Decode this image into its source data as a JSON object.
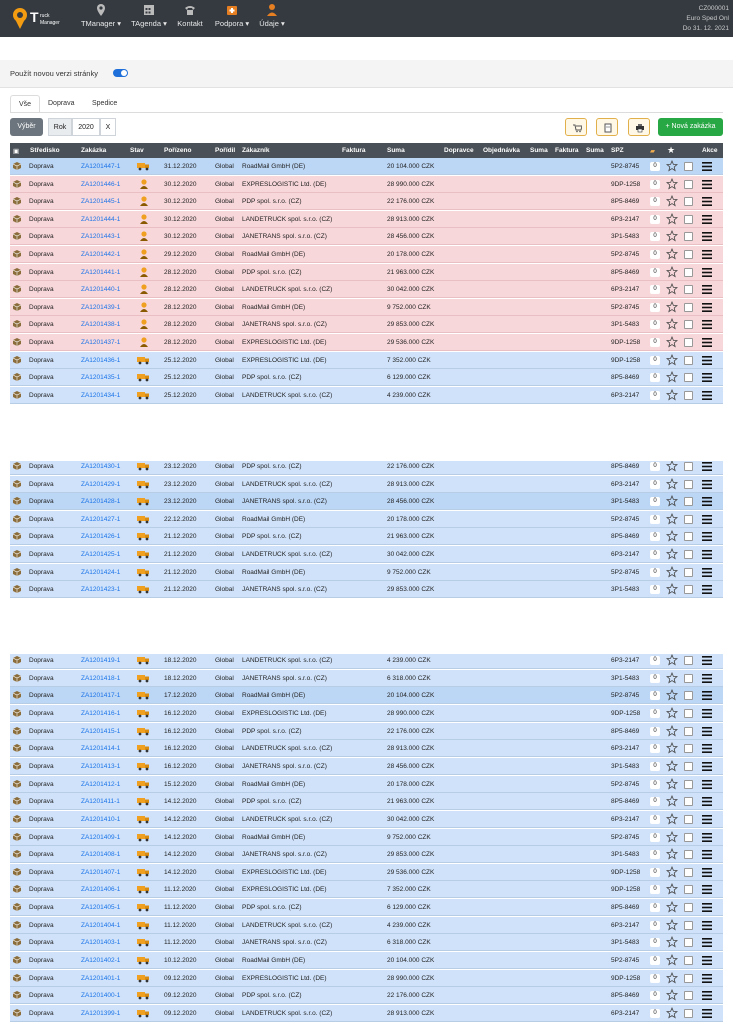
{
  "app": {
    "logo_text": "T",
    "logo_sub1": "ruck",
    "logo_sub2": "Manager",
    "company_id": "CZ000001",
    "company_name": "Euro Sped Onl",
    "valid_until": "Do 31. 12. 2021",
    "nav": [
      {
        "label": "TManager",
        "icon": "map-pin-icon"
      },
      {
        "label": "TAgenda",
        "icon": "calendar-grid-icon"
      },
      {
        "label": "Kontakt",
        "icon": "phone-icon"
      },
      {
        "label": "Podpora",
        "icon": "first-aid-icon"
      },
      {
        "label": "Údaje",
        "icon": "user-icon"
      }
    ]
  },
  "switch": {
    "label": "Použít novou verzi stránky",
    "on": true
  },
  "tabs": [
    "Vše",
    "Doprava",
    "Spedice"
  ],
  "filters": {
    "vyber": "Výběr",
    "rok_label": "Rok",
    "rok_value": "2020",
    "clear": "X",
    "new_order": "+ Nová zakázka"
  },
  "columns": {
    "stredisko": "Středisko",
    "zakazka": "Zakázka",
    "stav": "Stav",
    "porizeno": "Pořízeno",
    "poridil": "Pořídil",
    "zakaznik": "Zákazník",
    "faktura": "Faktura",
    "suma": "Suma",
    "dopravce": "Dopravce",
    "objednavka": "Objednávka",
    "suma2": "Suma",
    "faktura2": "Faktura",
    "suma3": "Suma",
    "spz": "SPZ",
    "akce": "Akce"
  },
  "colors": {
    "header": "#343a40",
    "row_blue": "#cfe2fa",
    "row_pink": "#f8d7da",
    "accent": "#1e6fd9",
    "green": "#28a745"
  },
  "rows": [
    {
      "s": "Doprava",
      "z": "ZA1201447-1",
      "icon": "truck",
      "d": "31.12.2020",
      "p": "Global",
      "c": "RoadMail GmbH (DE)",
      "sum": "20 104.000 CZK",
      "spz": "5P2-8745",
      "n": "0",
      "t": "hl"
    },
    {
      "s": "Doprava",
      "z": "ZA1201446-1",
      "icon": "person",
      "d": "30.12.2020",
      "p": "Global",
      "c": "EXPRESLOGISTIC Ltd. (DE)",
      "sum": "28 990.000 CZK",
      "spz": "9DP-1258",
      "n": "0",
      "t": "pink"
    },
    {
      "s": "Doprava",
      "z": "ZA1201445-1",
      "icon": "person",
      "d": "30.12.2020",
      "p": "Global",
      "c": "PDP spol. s.r.o. (CZ)",
      "sum": "22 176.000 CZK",
      "spz": "8P5-8469",
      "n": "0",
      "t": "pink"
    },
    {
      "s": "Doprava",
      "z": "ZA1201444-1",
      "icon": "person",
      "d": "30.12.2020",
      "p": "Global",
      "c": "LANDETRUCK spol. s.r.o. (CZ)",
      "sum": "28 913.000 CZK",
      "spz": "6P3-2147",
      "n": "0",
      "t": "pink"
    },
    {
      "s": "Doprava",
      "z": "ZA1201443-1",
      "icon": "person",
      "d": "30.12.2020",
      "p": "Global",
      "c": "JANETRANS spol. s.r.o. (CZ)",
      "sum": "28 456.000 CZK",
      "spz": "3P1-5483",
      "n": "0",
      "t": "pink"
    },
    {
      "s": "Doprava",
      "z": "ZA1201442-1",
      "icon": "person",
      "d": "29.12.2020",
      "p": "Global",
      "c": "RoadMail GmbH (DE)",
      "sum": "20 178.000 CZK",
      "spz": "5P2-8745",
      "n": "0",
      "t": "pink"
    },
    {
      "s": "Doprava",
      "z": "ZA1201441-1",
      "icon": "person",
      "d": "28.12.2020",
      "p": "Global",
      "c": "PDP spol. s.r.o. (CZ)",
      "sum": "21 963.000 CZK",
      "spz": "8P5-8469",
      "n": "0",
      "t": "pink"
    },
    {
      "s": "Doprava",
      "z": "ZA1201440-1",
      "icon": "person",
      "d": "28.12.2020",
      "p": "Global",
      "c": "LANDETRUCK spol. s.r.o. (CZ)",
      "sum": "30 042.000 CZK",
      "spz": "6P3-2147",
      "n": "0",
      "t": "pink"
    },
    {
      "s": "Doprava",
      "z": "ZA1201439-1",
      "icon": "person",
      "d": "28.12.2020",
      "p": "Global",
      "c": "RoadMail GmbH (DE)",
      "sum": "9 752.000 CZK",
      "spz": "5P2-8745",
      "n": "0",
      "t": "pink"
    },
    {
      "s": "Doprava",
      "z": "ZA1201438-1",
      "icon": "person",
      "d": "28.12.2020",
      "p": "Global",
      "c": "JANETRANS spol. s.r.o. (CZ)",
      "sum": "29 853.000 CZK",
      "spz": "3P1-5483",
      "n": "0",
      "t": "pink"
    },
    {
      "s": "Doprava",
      "z": "ZA1201437-1",
      "icon": "person",
      "d": "28.12.2020",
      "p": "Global",
      "c": "EXPRESLOGISTIC Ltd. (DE)",
      "sum": "29 536.000 CZK",
      "spz": "9DP-1258",
      "n": "0",
      "t": "pink"
    },
    {
      "s": "Doprava",
      "z": "ZA1201436-1",
      "icon": "truck",
      "d": "25.12.2020",
      "p": "Global",
      "c": "EXPRESLOGISTIC Ltd. (DE)",
      "sum": "7 352.000 CZK",
      "spz": "9DP-1258",
      "n": "0",
      "t": "blue"
    },
    {
      "s": "Doprava",
      "z": "ZA1201435-1",
      "icon": "truck",
      "d": "25.12.2020",
      "p": "Global",
      "c": "PDP spol. s.r.o. (CZ)",
      "sum": "6 129.000 CZK",
      "spz": "8P5-8469",
      "n": "0",
      "t": "blue"
    },
    {
      "s": "Doprava",
      "z": "ZA1201434-1",
      "icon": "truck",
      "d": "25.12.2020",
      "p": "Global",
      "c": "LANDETRUCK spol. s.r.o. (CZ)",
      "sum": "4 239.000 CZK",
      "spz": "6P3-2147",
      "n": "0",
      "t": "blue"
    },
    {
      "s": "Doprava",
      "z": "ZA1201430-1",
      "icon": "truck",
      "d": "23.12.2020",
      "p": "Global",
      "c": "PDP spol. s.r.o. (CZ)",
      "sum": "22 176.000 CZK",
      "spz": "8P5-8469",
      "n": "0",
      "t": "blue"
    },
    {
      "s": "Doprava",
      "z": "ZA1201429-1",
      "icon": "truck",
      "d": "23.12.2020",
      "p": "Global",
      "c": "LANDETRUCK spol. s.r.o. (CZ)",
      "sum": "28 913.000 CZK",
      "spz": "6P3-2147",
      "n": "0",
      "t": "blue"
    },
    {
      "s": "Doprava",
      "z": "ZA1201428-1",
      "icon": "truck",
      "d": "23.12.2020",
      "p": "Global",
      "c": "JANETRANS spol. s.r.o. (CZ)",
      "sum": "28 456.000 CZK",
      "spz": "3P1-5483",
      "n": "0",
      "t": "hl"
    },
    {
      "s": "Doprava",
      "z": "ZA1201427-1",
      "icon": "truck",
      "d": "22.12.2020",
      "p": "Global",
      "c": "RoadMail GmbH (DE)",
      "sum": "20 178.000 CZK",
      "spz": "5P2-8745",
      "n": "0",
      "t": "blue"
    },
    {
      "s": "Doprava",
      "z": "ZA1201426-1",
      "icon": "truck",
      "d": "21.12.2020",
      "p": "Global",
      "c": "PDP spol. s.r.o. (CZ)",
      "sum": "21 963.000 CZK",
      "spz": "8P5-8469",
      "n": "0",
      "t": "blue"
    },
    {
      "s": "Doprava",
      "z": "ZA1201425-1",
      "icon": "truck",
      "d": "21.12.2020",
      "p": "Global",
      "c": "LANDETRUCK spol. s.r.o. (CZ)",
      "sum": "30 042.000 CZK",
      "spz": "6P3-2147",
      "n": "0",
      "t": "blue"
    },
    {
      "s": "Doprava",
      "z": "ZA1201424-1",
      "icon": "truck",
      "d": "21.12.2020",
      "p": "Global",
      "c": "RoadMail GmbH (DE)",
      "sum": "9 752.000 CZK",
      "spz": "5P2-8745",
      "n": "0",
      "t": "blue"
    },
    {
      "s": "Doprava",
      "z": "ZA1201423-1",
      "icon": "truck",
      "d": "21.12.2020",
      "p": "Global",
      "c": "JANETRANS spol. s.r.o. (CZ)",
      "sum": "29 853.000 CZK",
      "spz": "3P1-5483",
      "n": "0",
      "t": "blue"
    },
    {
      "s": "Doprava",
      "z": "ZA1201419-1",
      "icon": "truck",
      "d": "18.12.2020",
      "p": "Global",
      "c": "LANDETRUCK spol. s.r.o. (CZ)",
      "sum": "4 239.000 CZK",
      "spz": "6P3-2147",
      "n": "0",
      "t": "blue"
    },
    {
      "s": "Doprava",
      "z": "ZA1201418-1",
      "icon": "truck",
      "d": "18.12.2020",
      "p": "Global",
      "c": "JANETRANS spol. s.r.o. (CZ)",
      "sum": "6 318.000 CZK",
      "spz": "3P1-5483",
      "n": "0",
      "t": "blue"
    },
    {
      "s": "Doprava",
      "z": "ZA1201417-1",
      "icon": "truck",
      "d": "17.12.2020",
      "p": "Global",
      "c": "RoadMail GmbH (DE)",
      "sum": "20 104.000 CZK",
      "spz": "5P2-8745",
      "n": "0",
      "t": "hl"
    },
    {
      "s": "Doprava",
      "z": "ZA1201416-1",
      "icon": "truck",
      "d": "16.12.2020",
      "p": "Global",
      "c": "EXPRESLOGISTIC Ltd. (DE)",
      "sum": "28 990.000 CZK",
      "spz": "9DP-1258",
      "n": "0",
      "t": "blue"
    },
    {
      "s": "Doprava",
      "z": "ZA1201415-1",
      "icon": "truck",
      "d": "16.12.2020",
      "p": "Global",
      "c": "PDP spol. s.r.o. (CZ)",
      "sum": "22 176.000 CZK",
      "spz": "8P5-8469",
      "n": "0",
      "t": "blue"
    },
    {
      "s": "Doprava",
      "z": "ZA1201414-1",
      "icon": "truck",
      "d": "16.12.2020",
      "p": "Global",
      "c": "LANDETRUCK spol. s.r.o. (CZ)",
      "sum": "28 913.000 CZK",
      "spz": "6P3-2147",
      "n": "0",
      "t": "blue"
    },
    {
      "s": "Doprava",
      "z": "ZA1201413-1",
      "icon": "truck",
      "d": "16.12.2020",
      "p": "Global",
      "c": "JANETRANS spol. s.r.o. (CZ)",
      "sum": "28 456.000 CZK",
      "spz": "3P1-5483",
      "n": "0",
      "t": "blue"
    },
    {
      "s": "Doprava",
      "z": "ZA1201412-1",
      "icon": "truck",
      "d": "15.12.2020",
      "p": "Global",
      "c": "RoadMail GmbH (DE)",
      "sum": "20 178.000 CZK",
      "spz": "5P2-8745",
      "n": "0",
      "t": "blue"
    },
    {
      "s": "Doprava",
      "z": "ZA1201411-1",
      "icon": "truck",
      "d": "14.12.2020",
      "p": "Global",
      "c": "PDP spol. s.r.o. (CZ)",
      "sum": "21 963.000 CZK",
      "spz": "8P5-8469",
      "n": "0",
      "t": "blue"
    },
    {
      "s": "Doprava",
      "z": "ZA1201410-1",
      "icon": "truck",
      "d": "14.12.2020",
      "p": "Global",
      "c": "LANDETRUCK spol. s.r.o. (CZ)",
      "sum": "30 042.000 CZK",
      "spz": "6P3-2147",
      "n": "0",
      "t": "blue"
    },
    {
      "s": "Doprava",
      "z": "ZA1201409-1",
      "icon": "truck",
      "d": "14.12.2020",
      "p": "Global",
      "c": "RoadMail GmbH (DE)",
      "sum": "9 752.000 CZK",
      "spz": "5P2-8745",
      "n": "0",
      "t": "blue"
    },
    {
      "s": "Doprava",
      "z": "ZA1201408-1",
      "icon": "truck",
      "d": "14.12.2020",
      "p": "Global",
      "c": "JANETRANS spol. s.r.o. (CZ)",
      "sum": "29 853.000 CZK",
      "spz": "3P1-5483",
      "n": "0",
      "t": "blue"
    },
    {
      "s": "Doprava",
      "z": "ZA1201407-1",
      "icon": "truck",
      "d": "14.12.2020",
      "p": "Global",
      "c": "EXPRESLOGISTIC Ltd. (DE)",
      "sum": "29 536.000 CZK",
      "spz": "9DP-1258",
      "n": "0",
      "t": "blue"
    },
    {
      "s": "Doprava",
      "z": "ZA1201406-1",
      "icon": "truck",
      "d": "11.12.2020",
      "p": "Global",
      "c": "EXPRESLOGISTIC Ltd. (DE)",
      "sum": "7 352.000 CZK",
      "spz": "9DP-1258",
      "n": "0",
      "t": "blue"
    },
    {
      "s": "Doprava",
      "z": "ZA1201405-1",
      "icon": "truck",
      "d": "11.12.2020",
      "p": "Global",
      "c": "PDP spol. s.r.o. (CZ)",
      "sum": "6 129.000 CZK",
      "spz": "8P5-8469",
      "n": "0",
      "t": "blue"
    },
    {
      "s": "Doprava",
      "z": "ZA1201404-1",
      "icon": "truck",
      "d": "11.12.2020",
      "p": "Global",
      "c": "LANDETRUCK spol. s.r.o. (CZ)",
      "sum": "4 239.000 CZK",
      "spz": "6P3-2147",
      "n": "0",
      "t": "blue"
    },
    {
      "s": "Doprava",
      "z": "ZA1201403-1",
      "icon": "truck",
      "d": "11.12.2020",
      "p": "Global",
      "c": "JANETRANS spol. s.r.o. (CZ)",
      "sum": "6 318.000 CZK",
      "spz": "3P1-5483",
      "n": "0",
      "t": "blue"
    },
    {
      "s": "Doprava",
      "z": "ZA1201402-1",
      "icon": "truck",
      "d": "10.12.2020",
      "p": "Global",
      "c": "RoadMail GmbH (DE)",
      "sum": "20 104.000 CZK",
      "spz": "5P2-8745",
      "n": "0",
      "t": "blue"
    },
    {
      "s": "Doprava",
      "z": "ZA1201401-1",
      "icon": "truck",
      "d": "09.12.2020",
      "p": "Global",
      "c": "EXPRESLOGISTIC Ltd. (DE)",
      "sum": "28 990.000 CZK",
      "spz": "9DP-1258",
      "n": "0",
      "t": "blue"
    },
    {
      "s": "Doprava",
      "z": "ZA1201400-1",
      "icon": "truck",
      "d": "09.12.2020",
      "p": "Global",
      "c": "PDP spol. s.r.o. (CZ)",
      "sum": "22 176.000 CZK",
      "spz": "8P5-8469",
      "n": "0",
      "t": "blue"
    },
    {
      "s": "Doprava",
      "z": "ZA1201399-1",
      "icon": "truck",
      "d": "09.12.2020",
      "p": "Global",
      "c": "LANDETRUCK spol. s.r.o. (CZ)",
      "sum": "28 913.000 CZK",
      "spz": "6P3-2147",
      "n": "0",
      "t": "blue"
    }
  ]
}
